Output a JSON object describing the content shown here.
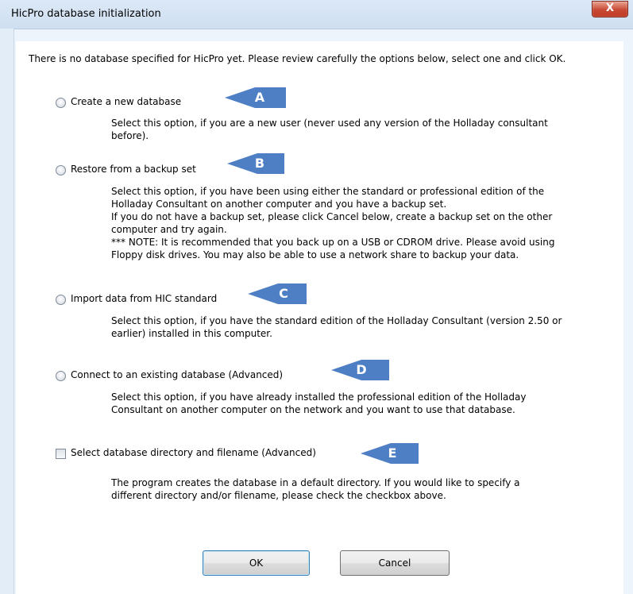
{
  "window": {
    "title": "HicPro database initialization",
    "close_glyph": "X"
  },
  "intro": "There is no database specified for HicPro yet. Please review carefully the options below, select one and click OK.",
  "options": [
    {
      "label": "Create a new database",
      "marker": "A",
      "desc": [
        "Select this option, if you are a new user (never used any version of the Holladay consultant",
        "before)."
      ]
    },
    {
      "label": "Restore from a backup set",
      "marker": "B",
      "desc": [
        "Select this option, if you have been using either the standard or professional edition of the",
        "Holladay Consultant on another computer and you have a backup set.",
        "If you do not have a backup set, please click Cancel below, create a backup set on the other",
        "computer and try again.",
        "*** NOTE: It is recommended that you back up on a USB or CDROM drive. Please avoid using",
        "Floppy disk drives. You may also be able to use a network share to backup your data."
      ]
    },
    {
      "label": "Import data from HIC standard",
      "marker": "C",
      "desc": [
        "Select this option, if you have the standard edition of the Holladay Consultant (version 2.50 or",
        "earlier) installed in this computer."
      ]
    },
    {
      "label": "Connect to an existing database (Advanced)",
      "marker": "D",
      "desc": [
        "Select this option, if you have already installed the professional edition of the Holladay",
        "Consultant on another computer on the network and you want to use that database."
      ]
    }
  ],
  "checkbox_option": {
    "label": "Select database directory and filename (Advanced)",
    "marker": "E",
    "checked": false,
    "desc": [
      "The program creates the database in a default directory. If you would like to specify a",
      "different directory and/or filename, please check the checkbox above."
    ]
  },
  "buttons": {
    "ok": "OK",
    "cancel": "Cancel"
  },
  "colors": {
    "arrow": "#4e7fc4",
    "close_button": "#c84a34"
  }
}
